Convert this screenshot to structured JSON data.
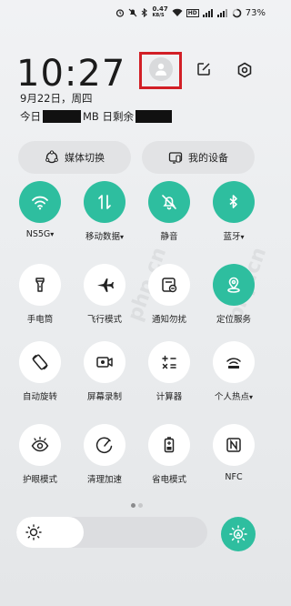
{
  "status_bar": {
    "speed": "0.47",
    "speed_unit": "KB/S",
    "battery_pct": "73%"
  },
  "header": {
    "time": "10:27",
    "date": "9月22日，周四",
    "data_prefix": "今日",
    "data_mid": "MB 日剩余"
  },
  "pills": {
    "media": "媒体切换",
    "devices": "我的设备"
  },
  "tiles": [
    {
      "label": "NS5G",
      "caret": true,
      "icon": "wifi-icon",
      "on": true
    },
    {
      "label": "移动数据",
      "caret": true,
      "icon": "mobile-data-icon",
      "on": true
    },
    {
      "label": "静音",
      "caret": false,
      "icon": "mute-bell-icon",
      "on": true
    },
    {
      "label": "蓝牙",
      "caret": true,
      "icon": "bluetooth-icon",
      "on": true
    },
    {
      "label": "手电筒",
      "caret": false,
      "icon": "flashlight-icon",
      "on": false
    },
    {
      "label": "飞行模式",
      "caret": false,
      "icon": "airplane-icon",
      "on": false
    },
    {
      "label": "通知勿扰",
      "caret": false,
      "icon": "dnd-icon",
      "on": false
    },
    {
      "label": "定位服务",
      "caret": false,
      "icon": "location-icon",
      "on": true
    },
    {
      "label": "自动旋转",
      "caret": false,
      "icon": "rotate-icon",
      "on": false
    },
    {
      "label": "屏幕录制",
      "caret": false,
      "icon": "screen-record-icon",
      "on": false
    },
    {
      "label": "计算器",
      "caret": false,
      "icon": "calculator-icon",
      "on": false
    },
    {
      "label": "个人热点",
      "caret": true,
      "icon": "hotspot-icon",
      "on": false
    },
    {
      "label": "护眼模式",
      "caret": false,
      "icon": "eye-icon",
      "on": false
    },
    {
      "label": "清理加速",
      "caret": false,
      "icon": "clean-icon",
      "on": false
    },
    {
      "label": "省电模式",
      "caret": false,
      "icon": "battery-saver-icon",
      "on": false
    },
    {
      "label": "NFC",
      "caret": false,
      "icon": "nfc-icon",
      "on": false
    }
  ],
  "brightness": {
    "level": 0.35
  },
  "colors": {
    "accent": "#2ebe9f",
    "highlight": "#d21f26"
  }
}
